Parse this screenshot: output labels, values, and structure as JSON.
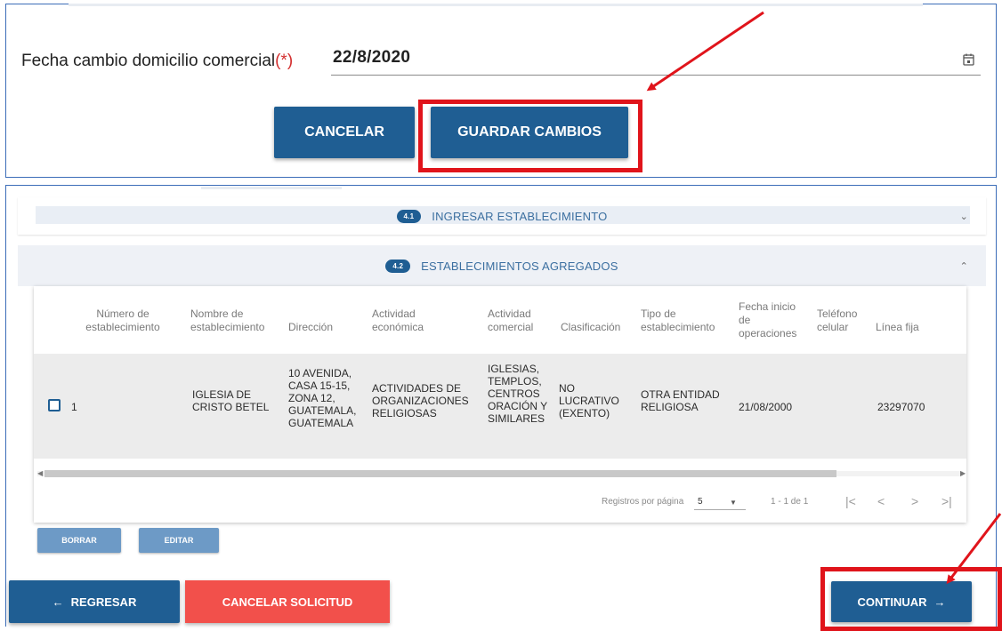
{
  "top_form": {
    "date_label": "Fecha cambio domicilio comercial",
    "date_required_mark": "(*)",
    "date_value": "22/8/2020",
    "cancel_label": "CANCELAR",
    "save_label": "GUARDAR CAMBIOS"
  },
  "accordion": {
    "section1": {
      "badge": "4.1",
      "title": "INGRESAR ESTABLECIMIENTO",
      "expanded": false
    },
    "section2": {
      "badge": "4.2",
      "title": "ESTABLECIMIENTOS AGREGADOS",
      "expanded": true
    }
  },
  "table": {
    "columns": [
      "Número de establecimiento",
      "Nombre de establecimiento",
      "Dirección",
      "Actividad económica",
      "Actividad comercial",
      "Clasificación",
      "Tipo de establecimiento",
      "Fecha inicio de operaciones",
      "Teléfono celular",
      "Línea fija"
    ],
    "rows": [
      {
        "numero": "1",
        "nombre": "IGLESIA DE CRISTO BETEL",
        "direccion": "10 AVENIDA, CASA 15-15, ZONA 12, GUATEMALA, GUATEMALA",
        "actividad_economica": "ACTIVIDADES DE ORGANIZACIONES RELIGIOSAS",
        "actividad_comercial": "IGLESIAS, TEMPLOS, CENTROS ORACIÓN Y SIMILARES",
        "clasificacion": "NO LUCRATIVO (EXENTO)",
        "tipo": "OTRA ENTIDAD RELIGIOSA",
        "fecha_inicio": "21/08/2000",
        "telefono_celular": "",
        "linea_fija": "23297070"
      }
    ]
  },
  "pagination": {
    "rows_per_page_label": "Registros por página",
    "rows_per_page_value": "5",
    "range_label": "1 - 1 de 1"
  },
  "table_actions": {
    "delete_label": "BORRAR",
    "edit_label": "EDITAR"
  },
  "footer": {
    "back_label": "REGRESAR",
    "cancel_request_label": "CANCELAR SOLICITUD",
    "continue_label": "CONTINUAR"
  },
  "colors": {
    "primary": "#1f5e93",
    "danger": "#f2504b",
    "highlight": "#e0141b",
    "panel_border": "#3c6db8"
  }
}
